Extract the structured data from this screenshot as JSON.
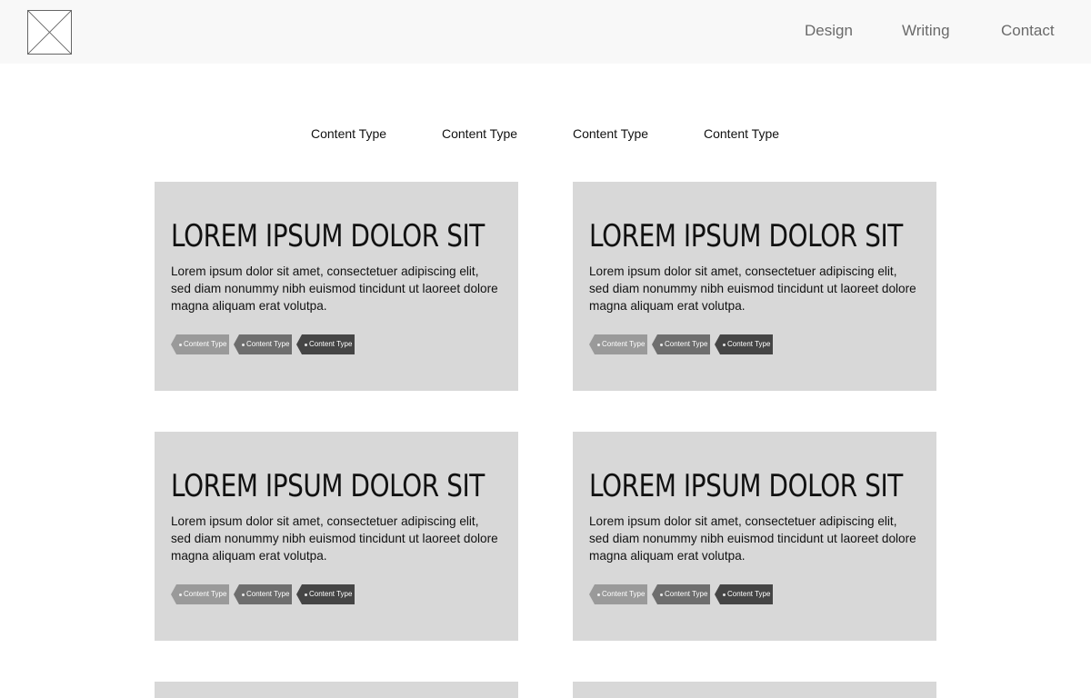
{
  "header": {
    "nav": [
      "Design",
      "Writing",
      "Contact"
    ]
  },
  "filters": [
    "Content Type",
    "Content Type",
    "Content Type",
    "Content Type"
  ],
  "cards": [
    {
      "title": "Lorem ipsum dolor sit",
      "body": "Lorem ipsum dolor sit amet, consectetuer adipiscing elit, sed diam nonummy nibh euismod tincidunt ut laoreet dolore magna aliquam erat volutpa.",
      "tags": [
        "Content Type",
        "Content Type",
        "Content Type"
      ]
    },
    {
      "title": "Lorem ipsum dolor sit",
      "body": "Lorem ipsum dolor sit amet, consectetuer adipiscing elit, sed diam nonummy nibh euismod tincidunt ut laoreet dolore magna aliquam erat volutpa.",
      "tags": [
        "Content Type",
        "Content Type",
        "Content Type"
      ]
    },
    {
      "title": "Lorem ipsum dolor sit",
      "body": "Lorem ipsum dolor sit amet, consectetuer adipiscing elit, sed diam nonummy nibh euismod tincidunt ut laoreet dolore magna aliquam erat volutpa.",
      "tags": [
        "Content Type",
        "Content Type",
        "Content Type"
      ]
    },
    {
      "title": "Lorem ipsum dolor sit",
      "body": "Lorem ipsum dolor sit amet, consectetuer adipiscing elit, sed diam nonummy nibh euismod tincidunt ut laoreet dolore magna aliquam erat volutpa.",
      "tags": [
        "Content Type",
        "Content Type",
        "Content Type"
      ]
    }
  ],
  "colors": {
    "header_bg": "#f8f8f8",
    "card_bg": "#d8d8d8",
    "tag_light": "#9a9a9a",
    "tag_mid": "#6e6e6e",
    "tag_dark": "#454545",
    "nav_text": "#6a6a6a"
  }
}
